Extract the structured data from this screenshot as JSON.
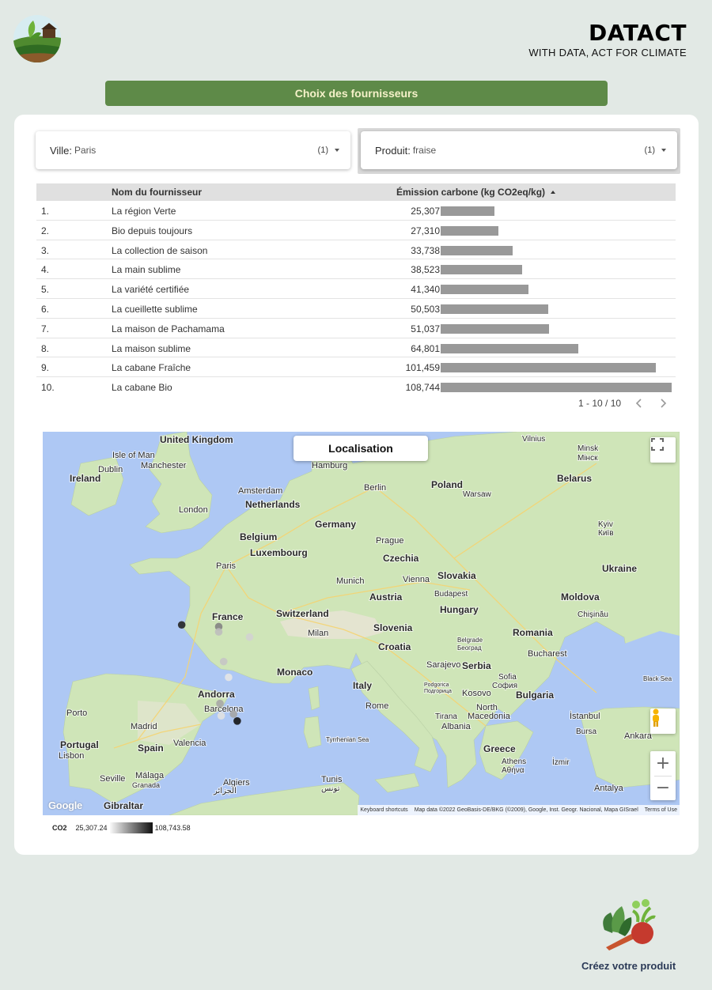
{
  "header": {
    "brand_title": "DATACT",
    "brand_subtitle": "WITH DATA, ACT FOR CLIMATE",
    "logo_icon": "farm-landscape-icon"
  },
  "banner": {
    "label": "Choix des fournisseurs"
  },
  "filters": {
    "city": {
      "label": "Ville:",
      "value": "Paris",
      "count": "(1)"
    },
    "product": {
      "label": "Produit:",
      "value": "fraise",
      "count": "(1)"
    }
  },
  "table": {
    "headers": {
      "name": "Nom du fournisseur",
      "emission": "Émission carbone (kg CO2eq/kg)"
    },
    "sort": "emission ascending",
    "bar_color": "#999999",
    "max_value": 108744,
    "rows": [
      {
        "index": "1.",
        "name": "La région Verte",
        "value_label": "25,307",
        "value": 25307
      },
      {
        "index": "2.",
        "name": "Bio depuis toujours",
        "value_label": "27,310",
        "value": 27310
      },
      {
        "index": "3.",
        "name": "La collection de saison",
        "value_label": "33,738",
        "value": 33738
      },
      {
        "index": "4.",
        "name": "La main sublime",
        "value_label": "38,523",
        "value": 38523
      },
      {
        "index": "5.",
        "name": "La variété certifiée",
        "value_label": "41,340",
        "value": 41340
      },
      {
        "index": "6.",
        "name": "La cueillette sublime",
        "value_label": "50,503",
        "value": 50503
      },
      {
        "index": "7.",
        "name": "La maison de Pachamama",
        "value_label": "51,037",
        "value": 51037
      },
      {
        "index": "8.",
        "name": "La maison sublime",
        "value_label": "64,801",
        "value": 64801
      },
      {
        "index": "9.",
        "name": "La cabane Fraîche",
        "value_label": "101,459",
        "value": 101459
      },
      {
        "index": "10.",
        "name": "La cabane Bio",
        "value_label": "108,744",
        "value": 108744
      }
    ],
    "pagination": "1 - 10 / 10"
  },
  "map": {
    "title": "Localisation",
    "google_logo": "Google",
    "attribution": {
      "shortcuts": "Keyboard shortcuts",
      "data": "Map data ©2022 GeoBasis-DE/BKG (©2009), Google, Inst. Geogr. Nacional, Mapa GISrael",
      "terms": "Terms of Use"
    },
    "colors": {
      "water": "#aec8f4",
      "land": "#cfe5b8",
      "land_alt": "#e8e4d6",
      "road": "#f5d472"
    },
    "places": {
      "united_kingdom": "United Kingdom",
      "isle_of_man": "Isle of Man",
      "ireland": "Ireland",
      "dublin": "Dublin",
      "manchester": "Manchester",
      "london": "London",
      "amsterdam": "Amsterdam",
      "netherlands": "Netherlands",
      "hamburg": "Hamburg",
      "berlin": "Berlin",
      "poland": "Poland",
      "warsaw": "Warsaw",
      "vilnius": "Vilnius",
      "minsk": "Minsk",
      "minsk_cyr": "Мінск",
      "belarus": "Belarus",
      "belgium": "Belgium",
      "germany": "Germany",
      "luxembourg": "Luxembourg",
      "prague": "Prague",
      "czechia": "Czechia",
      "kyiv": "Kyiv",
      "kyiv_cyr": "Київ",
      "paris": "Paris",
      "munich": "Munich",
      "vienna": "Vienna",
      "slovakia": "Slovakia",
      "ukraine": "Ukraine",
      "france": "France",
      "austria": "Austria",
      "budapest": "Budapest",
      "moldova": "Moldova",
      "chisinau": "Chişinău",
      "switzerland": "Switzerland",
      "hungary": "Hungary",
      "milan": "Milan",
      "slovenia": "Slovenia",
      "romania": "Romania",
      "belgrade": "Belgrade",
      "belgrade_cyr": "Београд",
      "croatia": "Croatia",
      "bucharest": "Bucharest",
      "sarajevo": "Sarajevo",
      "serbia": "Serbia",
      "monaco": "Monaco",
      "sofia": "Sofia",
      "sofia_cyr": "София",
      "black_sea": "Black Sea",
      "podgorica": "Podgorica",
      "podgorica_cyr": "Подгорица",
      "kosovo": "Kosovo",
      "bulgaria": "Bulgaria",
      "andorra": "Andorra",
      "italy": "Italy",
      "north": "North",
      "macedonia": "Macedonia",
      "barcelona": "Barcelona",
      "rome": "Rome",
      "tirana": "Tirana",
      "albania": "Albania",
      "istanbul": "İstanbul",
      "porto": "Porto",
      "madrid": "Madrid",
      "bursa": "Bursa",
      "ankara": "Ankara",
      "tyrrhenian_sea": "Tyrrhenian Sea",
      "portugal": "Portugal",
      "spain": "Spain",
      "valencia": "Valencia",
      "greece": "Greece",
      "lisbon": "Lisbon",
      "athens": "Athens",
      "athens_gr": "Αθήνα",
      "izmir": "İzmir",
      "seville": "Seville",
      "granada": "Granada",
      "algiers": "Algiers",
      "algiers_ar": "الجزائر",
      "tunis": "Tunis",
      "tunis_ar": "تونس",
      "malaga": "Málaga",
      "antalya": "Antalya",
      "gibraltar": "Gibraltar"
    },
    "points": [
      {
        "lon": -2.05,
        "lat": 47.55,
        "co2": 101459
      },
      {
        "lon": -0.55,
        "lat": 47.5,
        "co2": 64801
      },
      {
        "lon": -0.55,
        "lat": 47.35,
        "co2": 41340
      },
      {
        "lon": 0.7,
        "lat": 47.2,
        "co2": 33738
      },
      {
        "lon": -0.35,
        "lat": 46.5,
        "co2": 38523
      },
      {
        "lon": -0.15,
        "lat": 46.05,
        "co2": 25307
      },
      {
        "lon": -0.5,
        "lat": 45.3,
        "co2": 50503
      },
      {
        "lon": 0.2,
        "lat": 44.8,
        "co2": 108744
      },
      {
        "lon": -0.45,
        "lat": 44.95,
        "co2": 27310
      },
      {
        "lon": 0.05,
        "lat": 45.0,
        "co2": 51037
      }
    ]
  },
  "legend": {
    "key": "CO2",
    "min": "25,307.24",
    "max": "108,743.58"
  },
  "footer": {
    "cta": "Créez votre produit",
    "icon": "vegetables-icon"
  }
}
